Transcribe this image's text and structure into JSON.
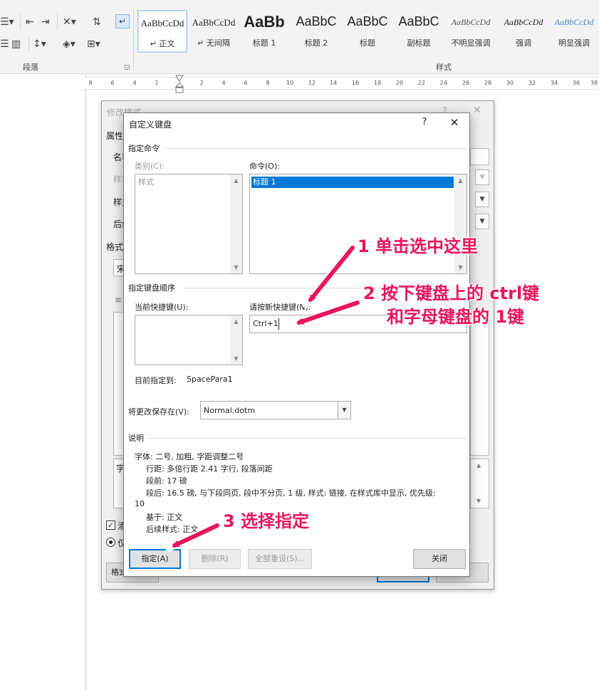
{
  "ribbon": {
    "paragraph_group_label": "段落",
    "styles_group_label": "样式",
    "styles": [
      {
        "sample": "AaBbCcDd",
        "name": "↵ 正文",
        "selected": true
      },
      {
        "sample": "AaBbCcDd",
        "name": "↵ 无间隔"
      },
      {
        "sample": "AaBb",
        "name": "标题 1"
      },
      {
        "sample": "AaBbC",
        "name": "标题 2"
      },
      {
        "sample": "AaBbC",
        "name": "标题"
      },
      {
        "sample": "AaBbC",
        "name": "副标题"
      },
      {
        "sample": "AaBbCcDd",
        "name": "不明显强调"
      },
      {
        "sample": "AaBbCcDd",
        "name": "强调"
      },
      {
        "sample": "AaBbCcDd",
        "name": "明显强调"
      }
    ]
  },
  "ruler": {
    "ticks": [
      "8",
      "6",
      "4",
      "2",
      "2",
      "4",
      "6",
      "8",
      "10",
      "12",
      "14",
      "16",
      "18",
      "20",
      "22",
      "24",
      "26",
      "28",
      "30",
      "32",
      "34",
      "36",
      "38"
    ]
  },
  "background_dialog": {
    "title": "修改样式",
    "help": "?",
    "close": "✕",
    "labels": [
      "属性",
      "名称",
      "样式",
      "样式",
      "后续",
      "格式",
      "宋",
      "字",
      "添",
      "仅",
      "格式"
    ]
  },
  "keyboard_dialog": {
    "title": "自定义键盘",
    "help": "?",
    "close": "✕",
    "assign_command_section": "指定命令",
    "category_label": "类别(C):",
    "categories": [
      "样式"
    ],
    "command_label": "命令(O):",
    "commands": [
      "标题 1"
    ],
    "key_sequence_section": "指定键盘顺序",
    "current_keys_label": "当前快捷键(U):",
    "current_keys": [],
    "new_key_label": "请按新快捷键(N):",
    "new_key_value": "Ctrl+1",
    "currently_assigned_label": "目前指定到:",
    "currently_assigned_value": "SpacePara1",
    "save_in_label": "将更改保存在(V):",
    "save_in_value": "Normal.dotm",
    "description_section": "说明",
    "description_lines": [
      "字体: 二号, 加粗, 字距调整二号",
      "行距: 多倍行距 2.41 字行, 段落间距",
      "段前: 17 磅",
      "段后: 16.5 磅, 与下段同页, 段中不分页, 1 级, 样式: 链接, 在样式库中显示, 优先级:",
      "10",
      "基于: 正文",
      "后续样式: 正文"
    ],
    "buttons": {
      "assign": "指定(A)",
      "remove": "删除(R)",
      "reset_all": "全部重设(S)...",
      "close": "关闭"
    }
  },
  "annotations": {
    "step1": "1 单击选中这里",
    "step2_line1": "2 按下键盘上的 ctrl键",
    "step2_line2": "和字母键盘的 1键",
    "step3": "3 选择指定"
  },
  "colors": {
    "annotation": "#e8155f",
    "selection": "#0078d7",
    "ribbon_bg": "#f3f3f3"
  }
}
